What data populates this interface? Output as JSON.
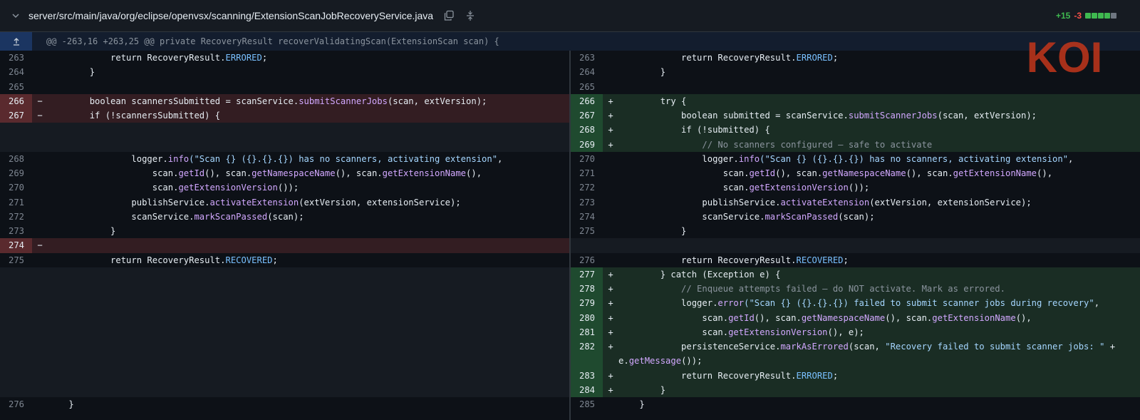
{
  "file": {
    "path": "server/src/main/java/org/eclipse/openvsx/scanning/ExtensionScanJobRecoveryService.java",
    "additions": "+15",
    "deletions": "-3",
    "diffstat_blocks": [
      "add",
      "add",
      "add",
      "add",
      "neutral"
    ]
  },
  "hunk": {
    "header": "@@ -263,16 +263,25 @@ private RecoveryResult recoverValidatingScan(ExtensionScan scan) {"
  },
  "logo_text": "KOI",
  "colors": {
    "addition": "#3fb950",
    "deletion": "#f85149",
    "logo": "#c2361b"
  },
  "left_rows": [
    {
      "type": "ctx",
      "num": "263",
      "segs": [
        {
          "t": "            return RecoveryResult."
        },
        {
          "t": "ERRORED",
          "c": "cst"
        },
        {
          "t": ";"
        }
      ]
    },
    {
      "type": "ctx",
      "num": "264",
      "segs": [
        {
          "t": "        }"
        }
      ]
    },
    {
      "type": "ctx",
      "num": "265",
      "segs": []
    },
    {
      "type": "del",
      "num": "266",
      "marker": "−",
      "segs": [
        {
          "t": "        boolean scannersSubmitted = scanService."
        },
        {
          "t": "submitScannerJobs",
          "c": "fn"
        },
        {
          "t": "(scan, extVersion);"
        }
      ]
    },
    {
      "type": "del",
      "num": "267",
      "marker": "−",
      "segs": [
        {
          "t": "        if (!scannersSubmitted) {"
        }
      ]
    },
    {
      "type": "empty"
    },
    {
      "type": "empty"
    },
    {
      "type": "ctx",
      "num": "268",
      "segs": [
        {
          "t": "                logger."
        },
        {
          "t": "info",
          "c": "fn"
        },
        {
          "t": "(\"Scan {} ({}.{}.{}) has no scanners, activating extension\"",
          "c": "str"
        },
        {
          "t": ","
        }
      ]
    },
    {
      "type": "ctx",
      "num": "269",
      "segs": [
        {
          "t": "                    scan."
        },
        {
          "t": "getId",
          "c": "fn"
        },
        {
          "t": "(), scan."
        },
        {
          "t": "getNamespaceName",
          "c": "fn"
        },
        {
          "t": "(), scan."
        },
        {
          "t": "getExtensionName",
          "c": "fn"
        },
        {
          "t": "(),"
        }
      ]
    },
    {
      "type": "ctx",
      "num": "270",
      "segs": [
        {
          "t": "                    scan."
        },
        {
          "t": "getExtensionVersion",
          "c": "fn"
        },
        {
          "t": "());"
        }
      ]
    },
    {
      "type": "ctx",
      "num": "271",
      "segs": [
        {
          "t": "                publishService."
        },
        {
          "t": "activateExtension",
          "c": "fn"
        },
        {
          "t": "(extVersion, extensionService);"
        }
      ]
    },
    {
      "type": "ctx",
      "num": "272",
      "segs": [
        {
          "t": "                scanService."
        },
        {
          "t": "markScanPassed",
          "c": "fn"
        },
        {
          "t": "(scan);"
        }
      ]
    },
    {
      "type": "ctx",
      "num": "273",
      "segs": [
        {
          "t": "            }"
        }
      ]
    },
    {
      "type": "del",
      "num": "274",
      "marker": "−",
      "segs": []
    },
    {
      "type": "ctx",
      "num": "275",
      "segs": [
        {
          "t": "            return RecoveryResult."
        },
        {
          "t": "RECOVERED",
          "c": "cst"
        },
        {
          "t": ";"
        }
      ]
    },
    {
      "type": "empty"
    },
    {
      "type": "empty"
    },
    {
      "type": "empty"
    },
    {
      "type": "empty"
    },
    {
      "type": "empty"
    },
    {
      "type": "empty"
    },
    {
      "type": "empty"
    },
    {
      "type": "empty"
    },
    {
      "type": "empty"
    },
    {
      "type": "ctx",
      "num": "276",
      "segs": [
        {
          "t": "    }"
        }
      ]
    }
  ],
  "right_rows": [
    {
      "type": "ctx",
      "num": "263",
      "segs": [
        {
          "t": "            return RecoveryResult."
        },
        {
          "t": "ERRORED",
          "c": "cst"
        },
        {
          "t": ";"
        }
      ]
    },
    {
      "type": "ctx",
      "num": "264",
      "segs": [
        {
          "t": "        }"
        }
      ]
    },
    {
      "type": "ctx",
      "num": "265",
      "segs": []
    },
    {
      "type": "add",
      "num": "266",
      "marker": "+",
      "segs": [
        {
          "t": "        try {"
        }
      ]
    },
    {
      "type": "add",
      "num": "267",
      "marker": "+",
      "segs": [
        {
          "t": "            boolean submitted = scanService."
        },
        {
          "t": "submitScannerJobs",
          "c": "fn"
        },
        {
          "t": "(scan, extVersion);"
        }
      ]
    },
    {
      "type": "add",
      "num": "268",
      "marker": "+",
      "segs": [
        {
          "t": "            if (!submitted) {"
        }
      ]
    },
    {
      "type": "add",
      "num": "269",
      "marker": "+",
      "segs": [
        {
          "t": "                // No scanners configured — safe to activate",
          "c": "cmt"
        }
      ]
    },
    {
      "type": "ctx",
      "num": "270",
      "segs": [
        {
          "t": "                logger."
        },
        {
          "t": "info",
          "c": "fn"
        },
        {
          "t": "(\"Scan {} ({}.{}.{}) has no scanners, activating extension\"",
          "c": "str"
        },
        {
          "t": ","
        }
      ]
    },
    {
      "type": "ctx",
      "num": "271",
      "segs": [
        {
          "t": "                    scan."
        },
        {
          "t": "getId",
          "c": "fn"
        },
        {
          "t": "(), scan."
        },
        {
          "t": "getNamespaceName",
          "c": "fn"
        },
        {
          "t": "(), scan."
        },
        {
          "t": "getExtensionName",
          "c": "fn"
        },
        {
          "t": "(),"
        }
      ]
    },
    {
      "type": "ctx",
      "num": "272",
      "segs": [
        {
          "t": "                    scan."
        },
        {
          "t": "getExtensionVersion",
          "c": "fn"
        },
        {
          "t": "());"
        }
      ]
    },
    {
      "type": "ctx",
      "num": "273",
      "segs": [
        {
          "t": "                publishService."
        },
        {
          "t": "activateExtension",
          "c": "fn"
        },
        {
          "t": "(extVersion, extensionService);"
        }
      ]
    },
    {
      "type": "ctx",
      "num": "274",
      "segs": [
        {
          "t": "                scanService."
        },
        {
          "t": "markScanPassed",
          "c": "fn"
        },
        {
          "t": "(scan);"
        }
      ]
    },
    {
      "type": "ctx",
      "num": "275",
      "segs": [
        {
          "t": "            }"
        }
      ]
    },
    {
      "type": "empty"
    },
    {
      "type": "ctx",
      "num": "276",
      "segs": [
        {
          "t": "            return RecoveryResult."
        },
        {
          "t": "RECOVERED",
          "c": "cst"
        },
        {
          "t": ";"
        }
      ]
    },
    {
      "type": "add",
      "num": "277",
      "marker": "+",
      "segs": [
        {
          "t": "        } catch (Exception e) {"
        }
      ]
    },
    {
      "type": "add",
      "num": "278",
      "marker": "+",
      "segs": [
        {
          "t": "            // Enqueue attempts failed — do NOT activate. Mark as errored.",
          "c": "cmt"
        }
      ]
    },
    {
      "type": "add",
      "num": "279",
      "marker": "+",
      "segs": [
        {
          "t": "            logger."
        },
        {
          "t": "error",
          "c": "fn"
        },
        {
          "t": "(\"Scan {} ({}.{}.{}) failed to submit scanner jobs during recovery\"",
          "c": "str"
        },
        {
          "t": ","
        }
      ]
    },
    {
      "type": "add",
      "num": "280",
      "marker": "+",
      "segs": [
        {
          "t": "                scan."
        },
        {
          "t": "getId",
          "c": "fn"
        },
        {
          "t": "(), scan."
        },
        {
          "t": "getNamespaceName",
          "c": "fn"
        },
        {
          "t": "(), scan."
        },
        {
          "t": "getExtensionName",
          "c": "fn"
        },
        {
          "t": "(),"
        }
      ]
    },
    {
      "type": "add",
      "num": "281",
      "marker": "+",
      "segs": [
        {
          "t": "                scan."
        },
        {
          "t": "getExtensionVersion",
          "c": "fn"
        },
        {
          "t": "(), e);"
        }
      ]
    },
    {
      "type": "add",
      "num": "282",
      "marker": "+",
      "segs": [
        {
          "t": "            persistenceService."
        },
        {
          "t": "markAsErrored",
          "c": "fn"
        },
        {
          "t": "(scan, "
        },
        {
          "t": "\"Recovery failed to submit scanner jobs: \"",
          "c": "str"
        },
        {
          "t": " +"
        }
      ]
    },
    {
      "type": "add-cont",
      "segs": [
        {
          "t": "e."
        },
        {
          "t": "getMessage",
          "c": "fn"
        },
        {
          "t": "());"
        }
      ]
    },
    {
      "type": "add",
      "num": "283",
      "marker": "+",
      "segs": [
        {
          "t": "            return RecoveryResult."
        },
        {
          "t": "ERRORED",
          "c": "cst"
        },
        {
          "t": ";"
        }
      ]
    },
    {
      "type": "add",
      "num": "284",
      "marker": "+",
      "segs": [
        {
          "t": "        }"
        }
      ]
    },
    {
      "type": "ctx",
      "num": "285",
      "segs": [
        {
          "t": "    }"
        }
      ]
    }
  ]
}
